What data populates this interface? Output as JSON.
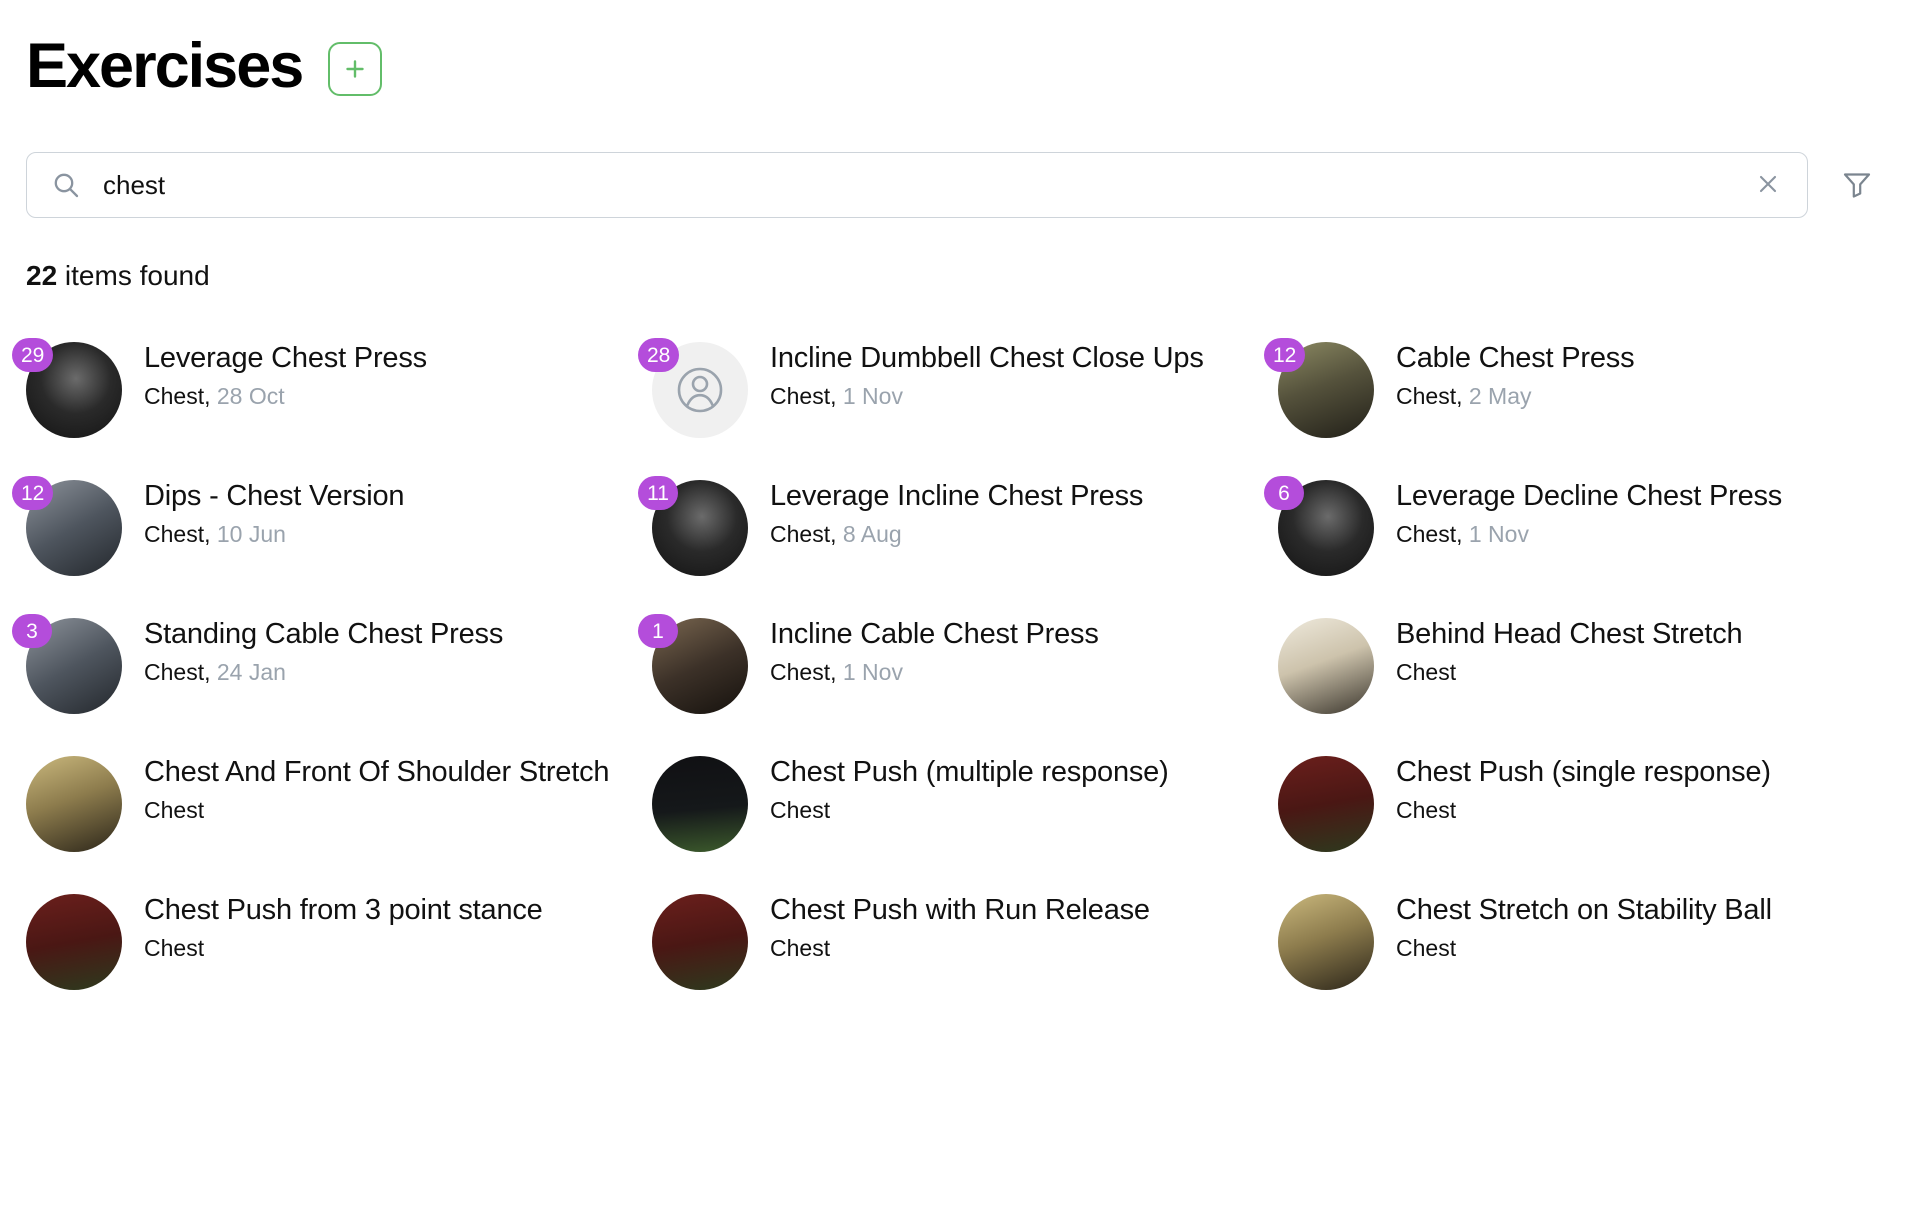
{
  "header": {
    "title": "Exercises",
    "add_button_label": "+",
    "add_button_icon": "plus-icon",
    "accent_color": "#62bd69"
  },
  "search": {
    "value": "chest",
    "placeholder": "Search",
    "search_icon": "search-icon",
    "clear_icon": "close-icon",
    "filter_icon": "filter-icon"
  },
  "results": {
    "count": "22",
    "label": " items found"
  },
  "badge_color": "#b44ddb",
  "items": [
    {
      "badge": "29",
      "title": "Leverage Chest Press",
      "category": "Chest",
      "separator": ", ",
      "date": "28 Oct",
      "thumb_type": "photo",
      "thumb_tone": "dark-gym"
    },
    {
      "badge": "28",
      "title": "Incline Dumbbell Chest Close Ups",
      "category": "Chest",
      "separator": ", ",
      "date": "1 Nov",
      "thumb_type": "placeholder",
      "thumb_tone": "grey"
    },
    {
      "badge": "12",
      "title": "Cable Chest Press",
      "category": "Chest",
      "separator": ", ",
      "date": "2 May",
      "thumb_type": "photo",
      "thumb_tone": "olive-gym"
    },
    {
      "badge": "12",
      "title": "Dips - Chest Version",
      "category": "Chest",
      "separator": ", ",
      "date": "10 Jun",
      "thumb_type": "photo",
      "thumb_tone": "steel-gym"
    },
    {
      "badge": "11",
      "title": "Leverage Incline Chest Press",
      "category": "Chest",
      "separator": ", ",
      "date": "8 Aug",
      "thumb_type": "photo",
      "thumb_tone": "dark-gym"
    },
    {
      "badge": "6",
      "title": "Leverage Decline Chest Press",
      "category": "Chest",
      "separator": ", ",
      "date": "1 Nov",
      "thumb_type": "photo",
      "thumb_tone": "dark-gym"
    },
    {
      "badge": "3",
      "title": "Standing Cable Chest Press",
      "category": "Chest",
      "separator": ", ",
      "date": "24 Jan",
      "thumb_type": "photo",
      "thumb_tone": "steel-gym"
    },
    {
      "badge": "1",
      "title": "Incline Cable Chest Press",
      "category": "Chest",
      "separator": ", ",
      "date": "1 Nov",
      "thumb_type": "photo",
      "thumb_tone": "brown-gym"
    },
    {
      "badge": "",
      "title": "Behind Head Chest Stretch",
      "category": "Chest",
      "separator": "",
      "date": "",
      "thumb_type": "photo",
      "thumb_tone": "studio"
    },
    {
      "badge": "",
      "title": "Chest And Front Of Shoulder Stretch",
      "category": "Chest",
      "separator": "",
      "date": "",
      "thumb_type": "photo",
      "thumb_tone": "tan-studio"
    },
    {
      "badge": "",
      "title": "Chest Push (multiple response)",
      "category": "Chest",
      "separator": "",
      "date": "",
      "thumb_type": "photo",
      "thumb_tone": "field-night"
    },
    {
      "badge": "",
      "title": "Chest Push (single response)",
      "category": "Chest",
      "separator": "",
      "date": "",
      "thumb_type": "photo",
      "thumb_tone": "red-field"
    },
    {
      "badge": "",
      "title": "Chest Push from 3 point stance",
      "category": "Chest",
      "separator": "",
      "date": "",
      "thumb_type": "photo",
      "thumb_tone": "red-field"
    },
    {
      "badge": "",
      "title": "Chest Push with Run Release",
      "category": "Chest",
      "separator": "",
      "date": "",
      "thumb_type": "photo",
      "thumb_tone": "red-field"
    },
    {
      "badge": "",
      "title": "Chest Stretch on Stability Ball",
      "category": "Chest",
      "separator": "",
      "date": "",
      "thumb_type": "photo",
      "thumb_tone": "tan-studio"
    }
  ]
}
